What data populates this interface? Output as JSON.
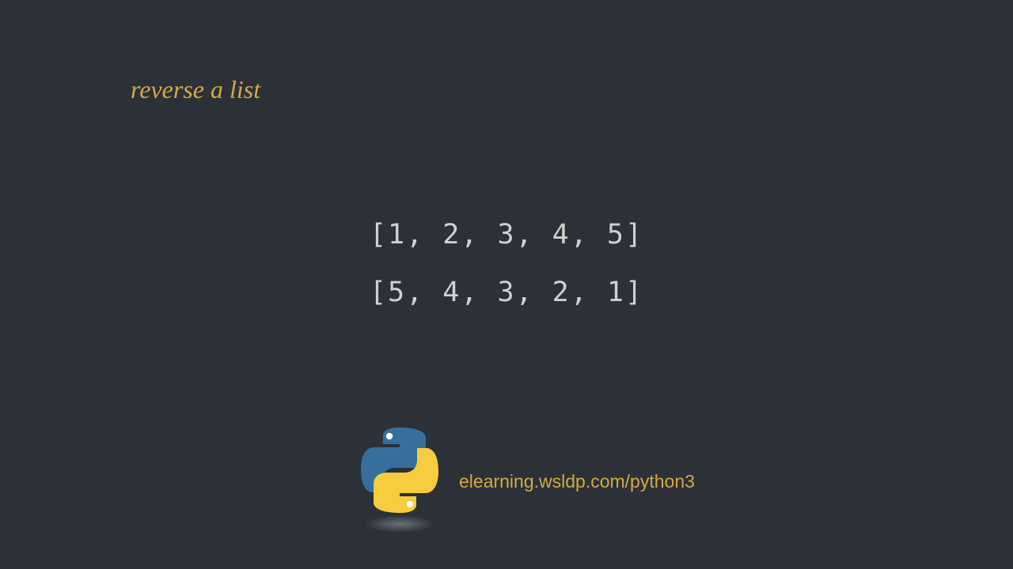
{
  "title": "reverse a list",
  "code": {
    "line1": "[1, 2, 3, 4, 5]",
    "line2": "[5, 4, 3, 2, 1]"
  },
  "footer": {
    "url": "elearning.wsldp.com/python3",
    "logo_name": "python-logo"
  },
  "colors": {
    "background": "#2b3137",
    "accent": "#d5a945",
    "code_text": "#cfd1d0",
    "python_blue": "#366f9e",
    "python_yellow": "#f7cc3f"
  }
}
